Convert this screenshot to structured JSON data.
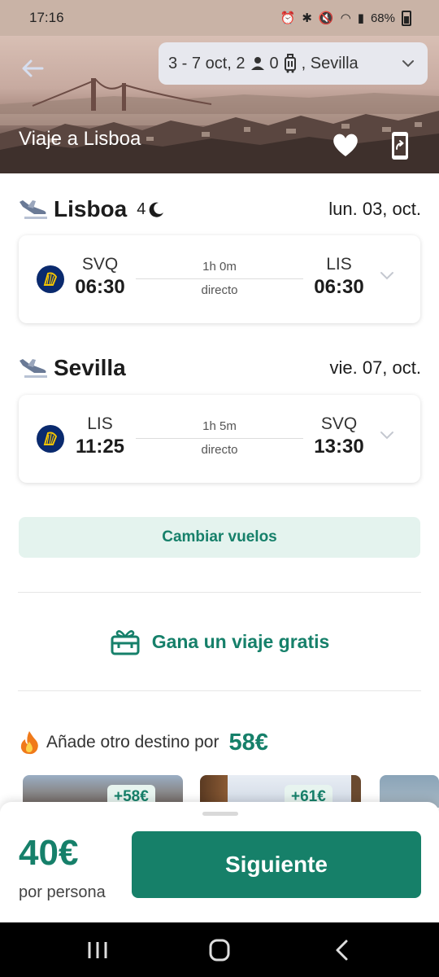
{
  "status_bar": {
    "time": "17:16",
    "battery": "68%",
    "icons": [
      "alarm-icon",
      "bluetooth-icon",
      "mute-icon",
      "wifi-icon",
      "signal-icon",
      "battery-icon"
    ]
  },
  "header": {
    "trip_dates": "3 - 7 oct, 2",
    "luggage_count": "0",
    "origin": ", Sevilla",
    "title": "Viaje a Lisboa"
  },
  "segments": [
    {
      "city": "Lisboa",
      "nights": "4",
      "date": "lun. 03, oct.",
      "flight": {
        "from_code": "SVQ",
        "from_time": "06:30",
        "duration": "1h 0m",
        "type": "directo",
        "to_code": "LIS",
        "to_time": "06:30"
      }
    },
    {
      "city": "Sevilla",
      "date": "vie. 07, oct.",
      "flight": {
        "from_code": "LIS",
        "from_time": "11:25",
        "duration": "1h 5m",
        "type": "directo",
        "to_code": "SVQ",
        "to_time": "13:30"
      }
    }
  ],
  "actions": {
    "change_flights": "Cambiar vuelos",
    "free_trip": "Gana un viaje gratis"
  },
  "add_destination": {
    "label": "Añade otro destino por",
    "price": "58€",
    "thumbs": [
      {
        "badge": "+58€"
      },
      {
        "badge": "+61€"
      }
    ]
  },
  "footer": {
    "total_price": "40€",
    "per_person": "por persona",
    "next_label": "Siguiente"
  },
  "colors": {
    "accent": "#168069",
    "accent_light": "#e4f3ee",
    "airline": "#0a2a6e"
  }
}
